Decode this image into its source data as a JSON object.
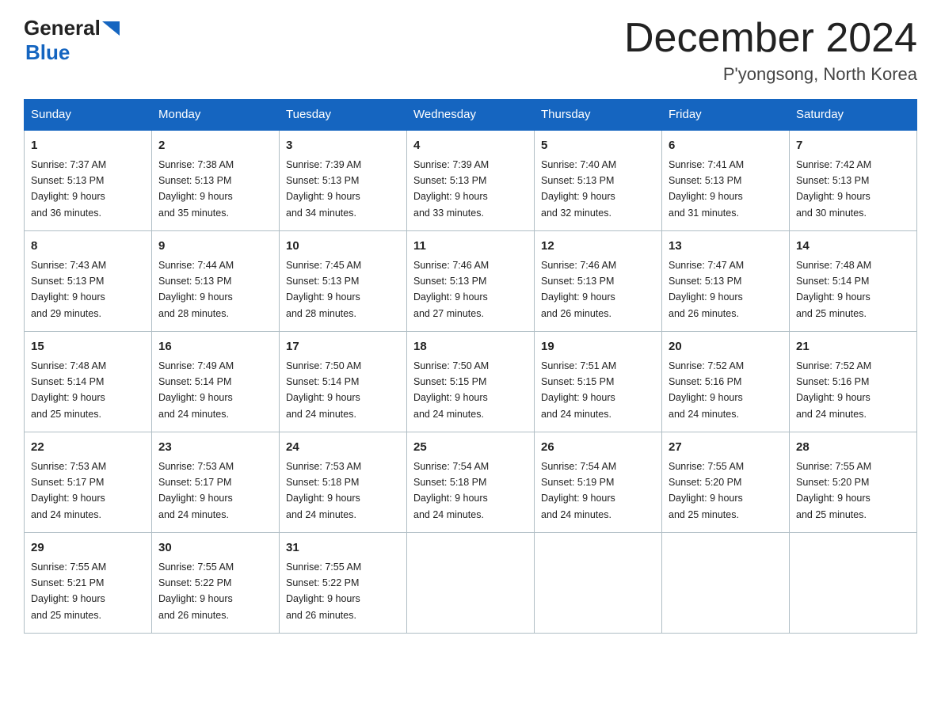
{
  "header": {
    "logo_general": "General",
    "logo_blue": "Blue",
    "month_title": "December 2024",
    "location": "P'yongsong, North Korea"
  },
  "days_of_week": [
    "Sunday",
    "Monday",
    "Tuesday",
    "Wednesday",
    "Thursday",
    "Friday",
    "Saturday"
  ],
  "weeks": [
    [
      {
        "day": "1",
        "sunrise": "7:37 AM",
        "sunset": "5:13 PM",
        "daylight": "9 hours and 36 minutes."
      },
      {
        "day": "2",
        "sunrise": "7:38 AM",
        "sunset": "5:13 PM",
        "daylight": "9 hours and 35 minutes."
      },
      {
        "day": "3",
        "sunrise": "7:39 AM",
        "sunset": "5:13 PM",
        "daylight": "9 hours and 34 minutes."
      },
      {
        "day": "4",
        "sunrise": "7:39 AM",
        "sunset": "5:13 PM",
        "daylight": "9 hours and 33 minutes."
      },
      {
        "day": "5",
        "sunrise": "7:40 AM",
        "sunset": "5:13 PM",
        "daylight": "9 hours and 32 minutes."
      },
      {
        "day": "6",
        "sunrise": "7:41 AM",
        "sunset": "5:13 PM",
        "daylight": "9 hours and 31 minutes."
      },
      {
        "day": "7",
        "sunrise": "7:42 AM",
        "sunset": "5:13 PM",
        "daylight": "9 hours and 30 minutes."
      }
    ],
    [
      {
        "day": "8",
        "sunrise": "7:43 AM",
        "sunset": "5:13 PM",
        "daylight": "9 hours and 29 minutes."
      },
      {
        "day": "9",
        "sunrise": "7:44 AM",
        "sunset": "5:13 PM",
        "daylight": "9 hours and 28 minutes."
      },
      {
        "day": "10",
        "sunrise": "7:45 AM",
        "sunset": "5:13 PM",
        "daylight": "9 hours and 28 minutes."
      },
      {
        "day": "11",
        "sunrise": "7:46 AM",
        "sunset": "5:13 PM",
        "daylight": "9 hours and 27 minutes."
      },
      {
        "day": "12",
        "sunrise": "7:46 AM",
        "sunset": "5:13 PM",
        "daylight": "9 hours and 26 minutes."
      },
      {
        "day": "13",
        "sunrise": "7:47 AM",
        "sunset": "5:13 PM",
        "daylight": "9 hours and 26 minutes."
      },
      {
        "day": "14",
        "sunrise": "7:48 AM",
        "sunset": "5:14 PM",
        "daylight": "9 hours and 25 minutes."
      }
    ],
    [
      {
        "day": "15",
        "sunrise": "7:48 AM",
        "sunset": "5:14 PM",
        "daylight": "9 hours and 25 minutes."
      },
      {
        "day": "16",
        "sunrise": "7:49 AM",
        "sunset": "5:14 PM",
        "daylight": "9 hours and 24 minutes."
      },
      {
        "day": "17",
        "sunrise": "7:50 AM",
        "sunset": "5:14 PM",
        "daylight": "9 hours and 24 minutes."
      },
      {
        "day": "18",
        "sunrise": "7:50 AM",
        "sunset": "5:15 PM",
        "daylight": "9 hours and 24 minutes."
      },
      {
        "day": "19",
        "sunrise": "7:51 AM",
        "sunset": "5:15 PM",
        "daylight": "9 hours and 24 minutes."
      },
      {
        "day": "20",
        "sunrise": "7:52 AM",
        "sunset": "5:16 PM",
        "daylight": "9 hours and 24 minutes."
      },
      {
        "day": "21",
        "sunrise": "7:52 AM",
        "sunset": "5:16 PM",
        "daylight": "9 hours and 24 minutes."
      }
    ],
    [
      {
        "day": "22",
        "sunrise": "7:53 AM",
        "sunset": "5:17 PM",
        "daylight": "9 hours and 24 minutes."
      },
      {
        "day": "23",
        "sunrise": "7:53 AM",
        "sunset": "5:17 PM",
        "daylight": "9 hours and 24 minutes."
      },
      {
        "day": "24",
        "sunrise": "7:53 AM",
        "sunset": "5:18 PM",
        "daylight": "9 hours and 24 minutes."
      },
      {
        "day": "25",
        "sunrise": "7:54 AM",
        "sunset": "5:18 PM",
        "daylight": "9 hours and 24 minutes."
      },
      {
        "day": "26",
        "sunrise": "7:54 AM",
        "sunset": "5:19 PM",
        "daylight": "9 hours and 24 minutes."
      },
      {
        "day": "27",
        "sunrise": "7:55 AM",
        "sunset": "5:20 PM",
        "daylight": "9 hours and 25 minutes."
      },
      {
        "day": "28",
        "sunrise": "7:55 AM",
        "sunset": "5:20 PM",
        "daylight": "9 hours and 25 minutes."
      }
    ],
    [
      {
        "day": "29",
        "sunrise": "7:55 AM",
        "sunset": "5:21 PM",
        "daylight": "9 hours and 25 minutes."
      },
      {
        "day": "30",
        "sunrise": "7:55 AM",
        "sunset": "5:22 PM",
        "daylight": "9 hours and 26 minutes."
      },
      {
        "day": "31",
        "sunrise": "7:55 AM",
        "sunset": "5:22 PM",
        "daylight": "9 hours and 26 minutes."
      },
      null,
      null,
      null,
      null
    ]
  ]
}
